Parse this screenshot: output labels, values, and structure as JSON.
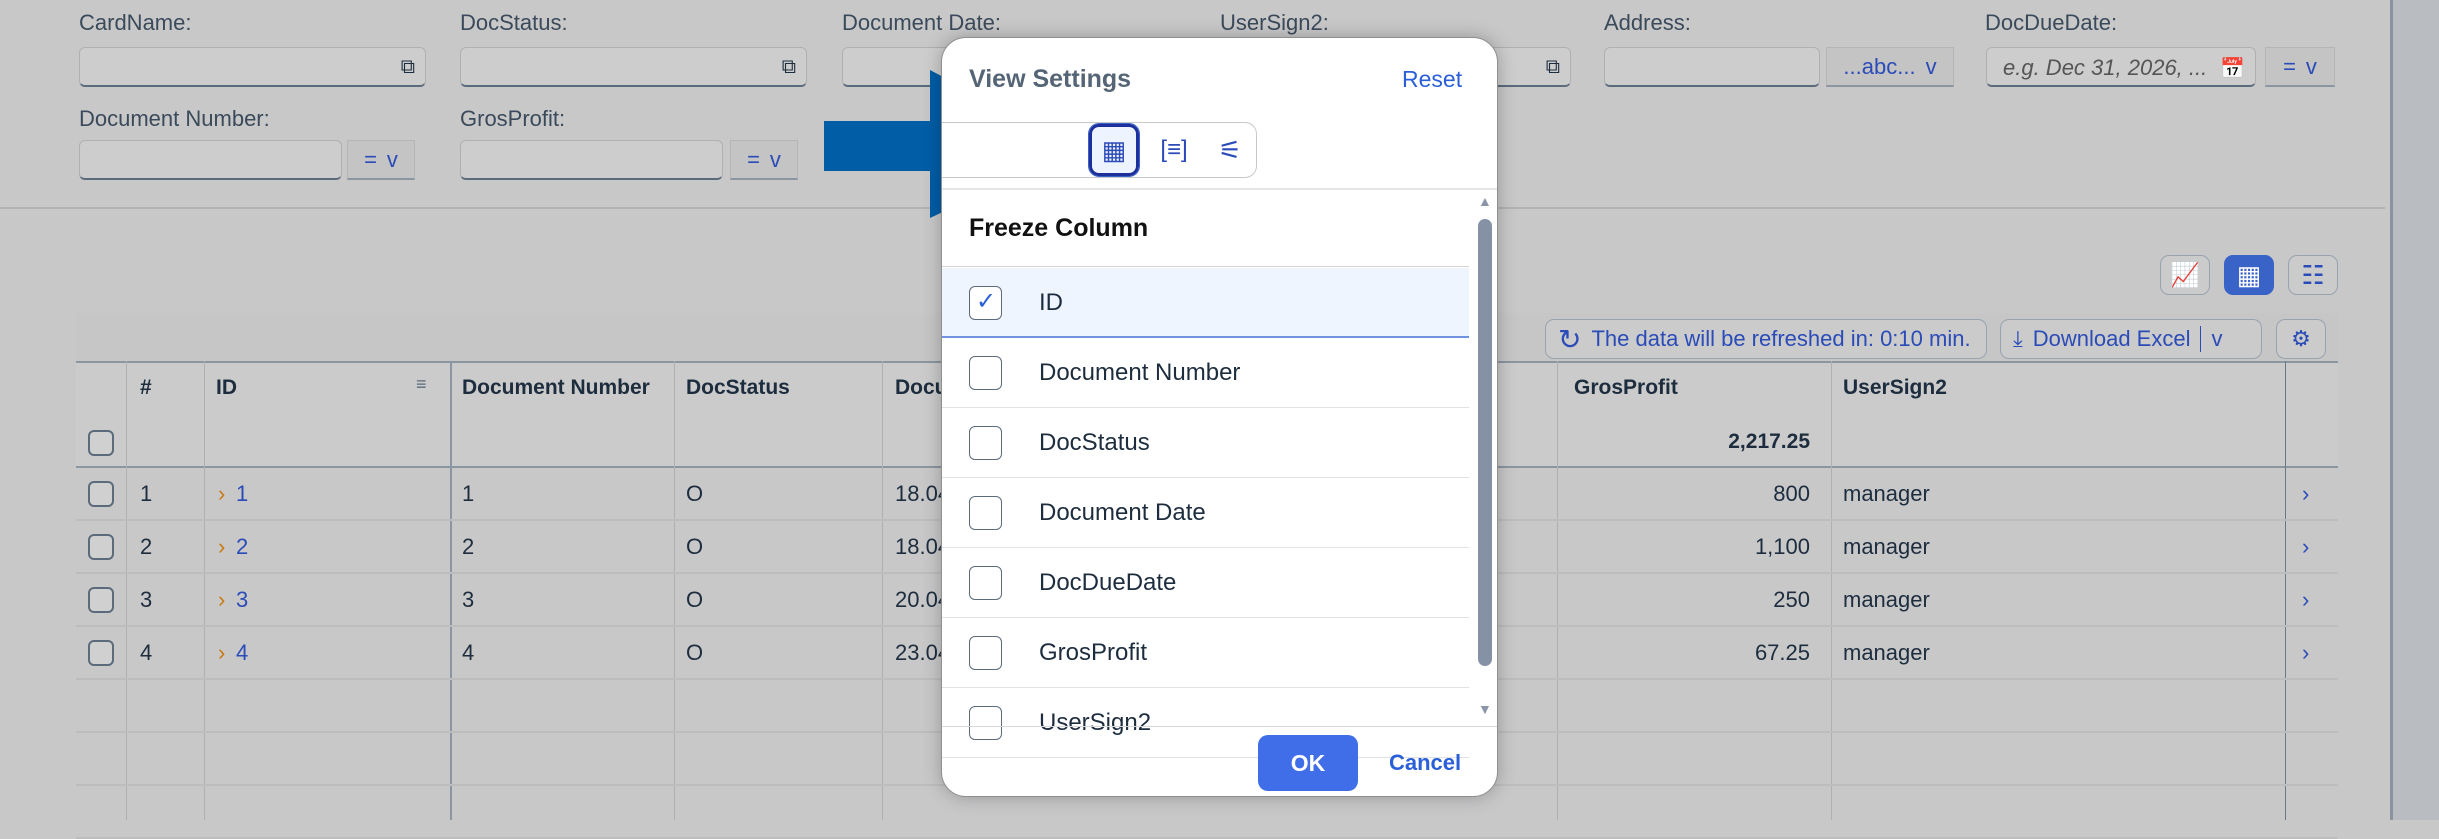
{
  "filters": {
    "row1": [
      {
        "label": "CardName:",
        "value": ""
      },
      {
        "label": "DocStatus:",
        "value": ""
      },
      {
        "label": "Document Date:",
        "value": ""
      },
      {
        "label": "UserSign2:",
        "value": ""
      },
      {
        "label": "Address:",
        "value": "",
        "operator": "...abc..."
      },
      {
        "label": "DocDueDate:",
        "placeholder": "e.g. Dec 31, 2026, ...",
        "operator": "="
      }
    ],
    "row2": [
      {
        "label": "Document Number:",
        "value": "",
        "operator": "="
      },
      {
        "label": "GrosProfit:",
        "value": "",
        "operator": "="
      }
    ],
    "chevron": "v"
  },
  "toolbar": {
    "views": [
      "chart-view",
      "table-view",
      "chart-table-view"
    ],
    "selected_view": "table-view",
    "refresh_text": "The data will be refreshed in: 0:10 min.",
    "download_label": "Download Excel"
  },
  "table": {
    "columns": [
      "#",
      "ID",
      "Document Number",
      "DocStatus",
      "Docu",
      "GrosProfit",
      "UserSign2"
    ],
    "totals": {
      "GrosProfit": "2,217.25"
    },
    "rows": [
      {
        "num": "1",
        "id": "1",
        "docnum": "1",
        "status": "O",
        "date": "18.04",
        "gp": "800",
        "user": "manager"
      },
      {
        "num": "2",
        "id": "2",
        "docnum": "2",
        "status": "O",
        "date": "18.04",
        "gp": "1,100",
        "user": "manager"
      },
      {
        "num": "3",
        "id": "3",
        "docnum": "3",
        "status": "O",
        "date": "20.04",
        "gp": "250",
        "user": "manager"
      },
      {
        "num": "4",
        "id": "4",
        "docnum": "4",
        "status": "O",
        "date": "23.04",
        "gp": "67.25",
        "user": "manager"
      }
    ]
  },
  "dialog": {
    "title": "View Settings",
    "reset": "Reset",
    "tabs": [
      "freeze-column",
      "sort",
      "filter-settings"
    ],
    "section_title": "Freeze Column",
    "items": [
      {
        "label": "ID",
        "checked": true
      },
      {
        "label": "Document Number",
        "checked": false
      },
      {
        "label": "DocStatus",
        "checked": false
      },
      {
        "label": "Document Date",
        "checked": false
      },
      {
        "label": "DocDueDate",
        "checked": false
      },
      {
        "label": "GrosProfit",
        "checked": false
      },
      {
        "label": "UserSign2",
        "checked": false
      }
    ],
    "ok": "OK",
    "cancel": "Cancel"
  },
  "colors": {
    "accent": "#3a63c8",
    "arrow": "#005da6",
    "link": "#2a4bb8",
    "expand": "#c87a10"
  }
}
